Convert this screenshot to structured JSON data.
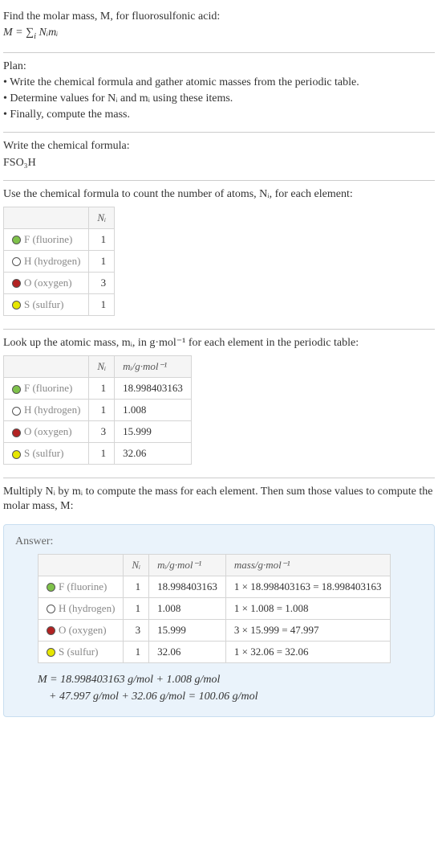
{
  "intro": {
    "line1": "Find the molar mass, M, for fluorosulfonic acid:",
    "eq": "M = ∑",
    "eq_sub": "i",
    "eq_tail": " Nᵢmᵢ"
  },
  "plan": {
    "heading": "Plan:",
    "b1": "• Write the chemical formula and gather atomic masses from the periodic table.",
    "b2": "• Determine values for Nᵢ and mᵢ using these items.",
    "b3": "• Finally, compute the mass."
  },
  "formula": {
    "line": "Write the chemical formula:",
    "value": "FSO₃H"
  },
  "count": {
    "line": "Use the chemical formula to count the number of atoms, Nᵢ, for each element:",
    "h1": "Nᵢ",
    "rows": [
      {
        "el": "F (fluorine)",
        "n": "1"
      },
      {
        "el": "H (hydrogen)",
        "n": "1"
      },
      {
        "el": "O (oxygen)",
        "n": "3"
      },
      {
        "el": "S (sulfur)",
        "n": "1"
      }
    ]
  },
  "masses": {
    "line": "Look up the atomic mass, mᵢ, in g·mol⁻¹ for each element in the periodic table:",
    "h1": "Nᵢ",
    "h2": "mᵢ/g·mol⁻¹",
    "rows": [
      {
        "el": "F (fluorine)",
        "n": "1",
        "m": "18.998403163"
      },
      {
        "el": "H (hydrogen)",
        "n": "1",
        "m": "1.008"
      },
      {
        "el": "O (oxygen)",
        "n": "3",
        "m": "15.999"
      },
      {
        "el": "S (sulfur)",
        "n": "1",
        "m": "32.06"
      }
    ]
  },
  "compute": {
    "line": "Multiply Nᵢ by mᵢ to compute the mass for each element. Then sum those values to compute the molar mass, M:"
  },
  "answer": {
    "label": "Answer:",
    "h1": "Nᵢ",
    "h2": "mᵢ/g·mol⁻¹",
    "h3": "mass/g·mol⁻¹",
    "rows": [
      {
        "el": "F (fluorine)",
        "n": "1",
        "m": "18.998403163",
        "mass": "1 × 18.998403163 = 18.998403163"
      },
      {
        "el": "H (hydrogen)",
        "n": "1",
        "m": "1.008",
        "mass": "1 × 1.008 = 1.008"
      },
      {
        "el": "O (oxygen)",
        "n": "3",
        "m": "15.999",
        "mass": "3 × 15.999 = 47.997"
      },
      {
        "el": "S (sulfur)",
        "n": "1",
        "m": "32.06",
        "mass": "1 × 32.06 = 32.06"
      }
    ],
    "final1": "M = 18.998403163 g/mol + 1.008 g/mol",
    "final2": "+ 47.997 g/mol + 32.06 g/mol = 100.06 g/mol"
  }
}
